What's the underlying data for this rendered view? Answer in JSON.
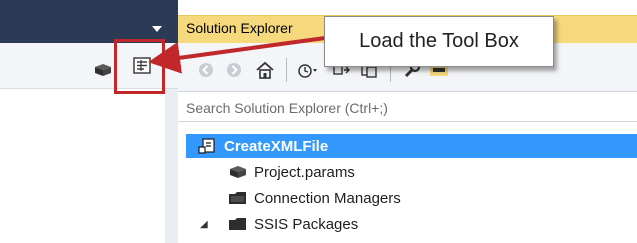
{
  "solution_explorer": {
    "title": "Solution Explorer",
    "search_placeholder": "Search Solution Explorer (Ctrl+;)",
    "toolbar_icons": [
      "back-icon",
      "forward-icon",
      "home-icon",
      "history-icon",
      "sync-icon",
      "refresh-icon",
      "properties-wrench-icon",
      "pin-icon"
    ],
    "tree": [
      {
        "label": "CreateXMLFile",
        "icon": "project-icon",
        "selected": true
      },
      {
        "label": "Project.params",
        "icon": "params-icon",
        "selected": false
      },
      {
        "label": "Connection Managers",
        "icon": "folder-icon",
        "selected": false
      },
      {
        "label": "SSIS Packages",
        "icon": "folder-icon",
        "selected": false,
        "expanded": true
      }
    ]
  },
  "callout": {
    "text": "Load the Tool Box"
  },
  "colors": {
    "titlebar": "#f5d97c",
    "selection": "#3399ff",
    "highlight_border": "#c0282c",
    "dark_header": "#2b3a55"
  }
}
